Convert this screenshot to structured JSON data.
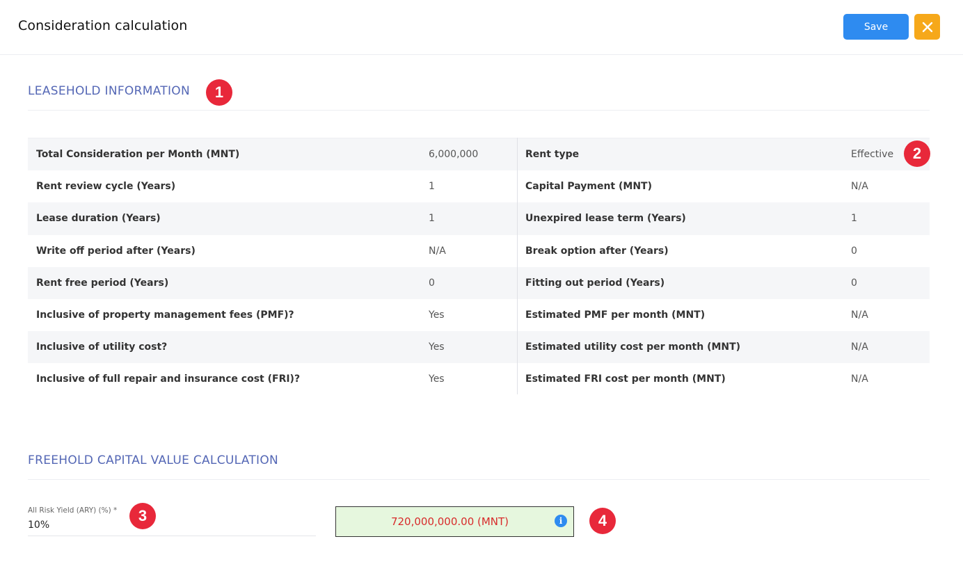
{
  "header": {
    "title": "Consideration calculation",
    "save_label": "Save",
    "close_icon": "close-icon"
  },
  "colors": {
    "accent": "#2e8bf0",
    "close_button": "#f6a81a",
    "section_title": "#5467b5",
    "badge": "#e8283a",
    "result_bg": "#e6f7de",
    "result_text": "#d82b2b"
  },
  "leasehold": {
    "title": "LEASEHOLD INFORMATION",
    "rows": [
      {
        "left_label": "Total Consideration per Month (MNT)",
        "left_value": "6,000,000",
        "right_label": "Rent type",
        "right_value": "Effective"
      },
      {
        "left_label": "Rent review cycle (Years)",
        "left_value": "1",
        "right_label": "Capital Payment (MNT)",
        "right_value": "N/A"
      },
      {
        "left_label": "Lease duration (Years)",
        "left_value": "1",
        "right_label": "Unexpired lease term (Years)",
        "right_value": "1"
      },
      {
        "left_label": "Write off period after (Years)",
        "left_value": "N/A",
        "right_label": "Break option after (Years)",
        "right_value": "0"
      },
      {
        "left_label": "Rent free period (Years)",
        "left_value": "0",
        "right_label": "Fitting out period (Years)",
        "right_value": "0"
      },
      {
        "left_label": "Inclusive of property management fees (PMF)?",
        "left_value": "Yes",
        "right_label": "Estimated PMF per month (MNT)",
        "right_value": "N/A"
      },
      {
        "left_label": "Inclusive of utility cost?",
        "left_value": "Yes",
        "right_label": "Estimated utility cost per month (MNT)",
        "right_value": "N/A"
      },
      {
        "left_label": "Inclusive of full repair and insurance cost (FRI)?",
        "left_value": "Yes",
        "right_label": "Estimated FRI cost per month (MNT)",
        "right_value": "N/A"
      }
    ]
  },
  "freehold": {
    "title": "FREEHOLD CAPITAL VALUE CALCULATION",
    "ary_label": "All Risk Yield (ARY) (%) *",
    "ary_value": "10%",
    "result": "720,000,000.00 (MNT)",
    "info_icon": "info-icon"
  },
  "badges": [
    "1",
    "2",
    "3",
    "4"
  ]
}
